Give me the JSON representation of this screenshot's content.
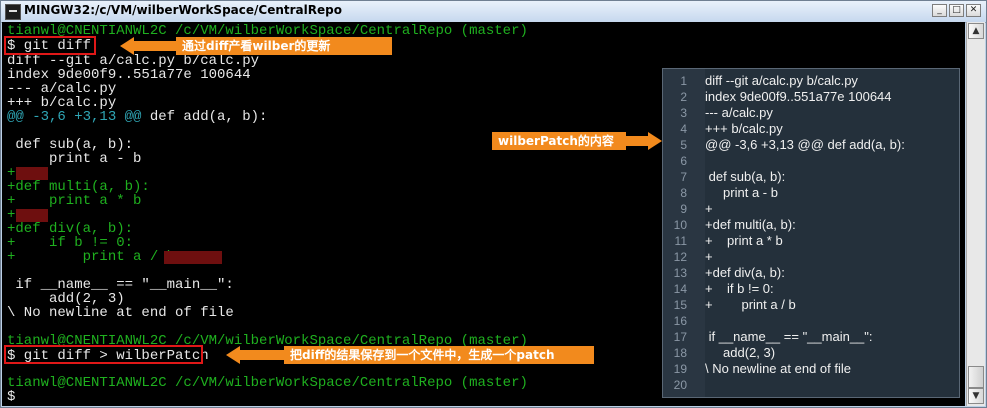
{
  "window": {
    "title": "MINGW32:/c/VM/wilberWorkSpace/CentralRepo",
    "controls": [
      "_",
      "□",
      "✕"
    ]
  },
  "console_lines": [
    {
      "text": "tianwl@CNENTIANWL2C /c/VM/wilberWorkSpace/CentralRepo (master)",
      "color": "green"
    },
    {
      "text": "$ git diff",
      "color": "white"
    },
    {
      "text": "diff --git a/calc.py b/calc.py",
      "color": "white"
    },
    {
      "text": "index 9de00f9..551a77e 100644",
      "color": "white"
    },
    {
      "text": "--- a/calc.py",
      "color": "white"
    },
    {
      "text": "+++ b/calc.py",
      "color": "white"
    },
    {
      "text": "@@ -3,6 +3,13 @@ def add(a, b):",
      "color": "mixed"
    },
    {
      "text": "",
      "color": "white"
    },
    {
      "text": " def sub(a, b):",
      "color": "white"
    },
    {
      "text": "     print a - b",
      "color": "white"
    },
    {
      "text": "+",
      "color": "green"
    },
    {
      "text": "+def multi(a, b):",
      "color": "green"
    },
    {
      "text": "+    print a * b",
      "color": "green"
    },
    {
      "text": "+",
      "color": "green"
    },
    {
      "text": "+def div(a, b):",
      "color": "green"
    },
    {
      "text": "+    if b != 0:",
      "color": "green"
    },
    {
      "text": "+        print a / b",
      "color": "green"
    },
    {
      "text": "",
      "color": "white"
    },
    {
      "text": " if __name__ == \"__main__\":",
      "color": "white"
    },
    {
      "text": "     add(2, 3)",
      "color": "white"
    },
    {
      "text": "\\ No newline at end of file",
      "color": "white"
    },
    {
      "text": "tianwl@CNENTIANWL2C /c/VM/wilberWorkSpace/CentralRepo (master)",
      "color": "green"
    },
    {
      "text": "$ git diff > wilberPatch",
      "color": "white"
    },
    {
      "text": "",
      "color": "white"
    },
    {
      "text": "tianwl@CNENTIANWL2C /c/VM/wilberWorkSpace/CentralRepo (master)",
      "color": "green"
    },
    {
      "text": "$",
      "color": "white"
    }
  ],
  "hunk_header": {
    "marker": "@@ -3,6 +3,13 @@",
    "rest": " def add(a, b):"
  },
  "annotations": {
    "diff_callout": "通过diff产看wilber的更新",
    "patch_callout": "wilberPatch的内容",
    "save_callout": "把diff的结果保存到一个文件中，生成一个patch"
  },
  "patch_file": {
    "lines": [
      "diff --git a/calc.py b/calc.py",
      "index 9de00f9..551a77e 100644",
      "--- a/calc.py",
      "+++ b/calc.py",
      "@@ -3,6 +3,13 @@ def add(a, b):",
      "",
      " def sub(a, b):",
      "     print a - b",
      "+",
      "+def multi(a, b):",
      "+    print a * b",
      "+",
      "+def div(a, b):",
      "+    if b != 0:",
      "+        print a / b",
      "",
      " if __name__ == \"__main__\":",
      "     add(2, 3)",
      "\\ No newline at end of file",
      ""
    ],
    "line_numbers": [
      "1",
      "2",
      "3",
      "4",
      "5",
      "6",
      "7",
      "8",
      "9",
      "10",
      "11",
      "12",
      "13",
      "14",
      "15",
      "16",
      "17",
      "18",
      "19",
      "20"
    ]
  },
  "colors": {
    "prompt_green": "#1fb01f",
    "hunk_cyan": "#2fa6b5",
    "highlight_red": "#e01818",
    "callout_orange": "#f28a1d"
  }
}
